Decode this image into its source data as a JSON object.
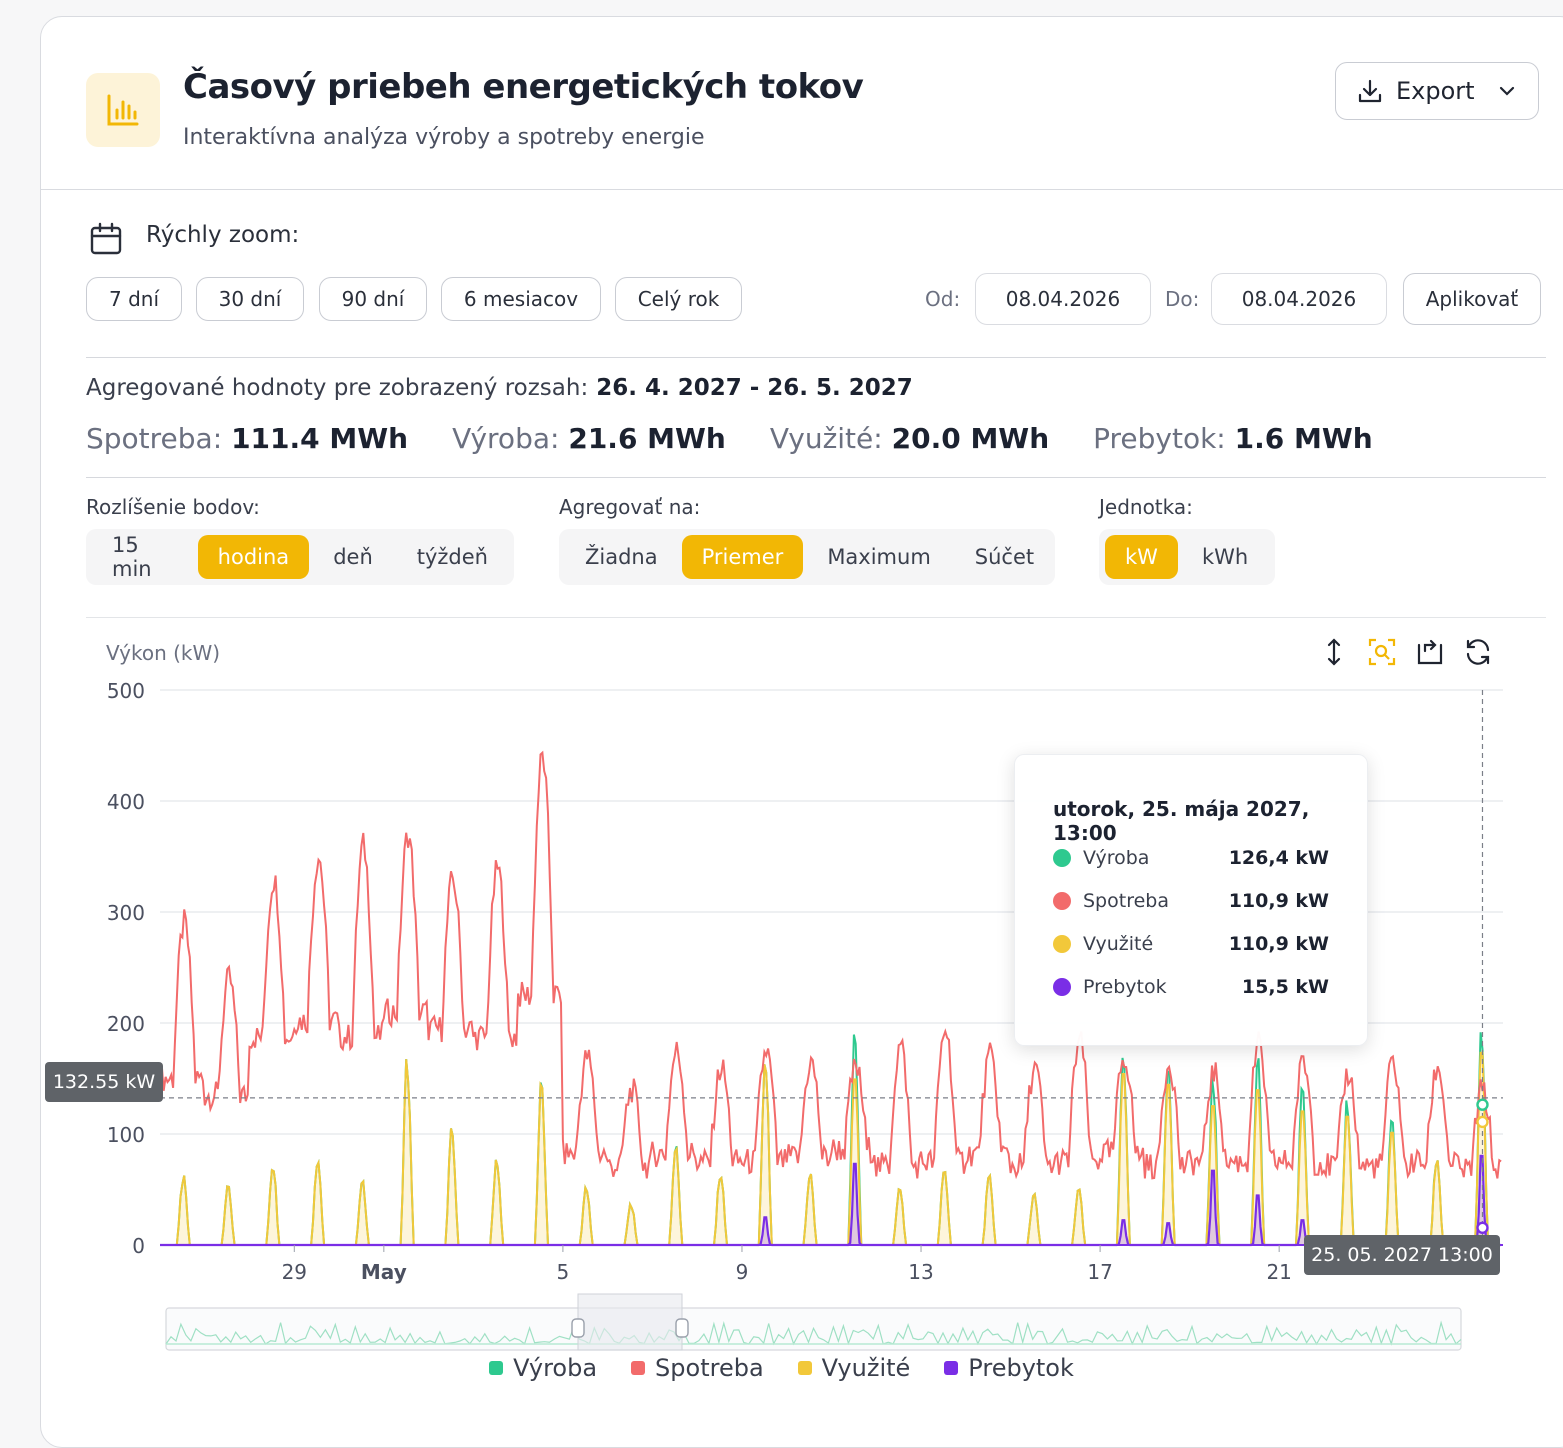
{
  "header": {
    "title": "Časový priebeh energetických tokov",
    "subtitle": "Interaktívna analýza výroby a spotreby energie",
    "export_label": "Export"
  },
  "zoom": {
    "label": "Rýchly zoom:",
    "buttons": [
      "7 dní",
      "30 dní",
      "90 dní",
      "6 mesiacov",
      "Celý rok"
    ],
    "from_label": "Od:",
    "from_value": "08.04.2026",
    "to_label": "Do:",
    "to_value": "08.04.2026",
    "apply_label": "Aplikovať"
  },
  "aggregate": {
    "label": "Agregované hodnoty pre zobrazený rozsah:",
    "range": "26. 4. 2027 - 26. 5. 2027",
    "stats": [
      {
        "label": "Spotreba:",
        "value": "111.4 MWh"
      },
      {
        "label": "Výroba:",
        "value": "21.6 MWh"
      },
      {
        "label": "Využité:",
        "value": "20.0 MWh"
      },
      {
        "label": "Prebytok:",
        "value": "1.6 MWh"
      }
    ]
  },
  "controls": {
    "resolution_label": "Rozlíšenie bodov:",
    "resolution_options": [
      "15 min",
      "hodina",
      "deň",
      "týždeň"
    ],
    "resolution_active": "hodina",
    "aggregate_label": "Agregovať na:",
    "aggregate_options": [
      "Žiadna",
      "Priemer",
      "Maximum",
      "Súčet"
    ],
    "aggregate_active": "Priemer",
    "unit_label": "Jednotka:",
    "unit_options": [
      "kW",
      "kWh"
    ],
    "unit_active": "kW"
  },
  "colors": {
    "accent": "#f2b705",
    "vyroba": "#2ec98f",
    "spotreba": "#f26b6b",
    "vyuzite": "#f2c83a",
    "prebytok": "#7a2ee6"
  },
  "tooltip": {
    "title": "utorok, 25. mája 2027, 13:00",
    "rows": [
      {
        "name": "Výroba",
        "value": "126,4 kW"
      },
      {
        "name": "Spotreba",
        "value": "110,9 kW"
      },
      {
        "name": "Využité",
        "value": "110,9 kW"
      },
      {
        "name": "Prebytok",
        "value": "15,5 kW"
      }
    ]
  },
  "crosshair": {
    "y_label": "132.55 kW",
    "x_label": "25. 05. 2027 13:00"
  },
  "chart_data": {
    "type": "line",
    "ylabel": "Výkon (kW)",
    "ylim": [
      0,
      500
    ],
    "yticks": [
      0,
      100,
      200,
      300,
      400,
      500
    ],
    "xlim": [
      "2027-04-26",
      "2027-05-26"
    ],
    "xticks": [
      {
        "label": "29",
        "date": "2027-04-29"
      },
      {
        "label": "May",
        "date": "2027-05-01"
      },
      {
        "label": "5",
        "date": "2027-05-05"
      },
      {
        "label": "9",
        "date": "2027-05-09"
      },
      {
        "label": "13",
        "date": "2027-05-13"
      },
      {
        "label": "17",
        "date": "2027-05-17"
      },
      {
        "label": "21",
        "date": "2027-05-21"
      }
    ],
    "grid": true,
    "legend": "bottom",
    "daily": {
      "dates": [
        "2027-04-26",
        "2027-04-27",
        "2027-04-28",
        "2027-04-29",
        "2027-04-30",
        "2027-05-01",
        "2027-05-02",
        "2027-05-03",
        "2027-05-04",
        "2027-05-05",
        "2027-05-06",
        "2027-05-07",
        "2027-05-08",
        "2027-05-09",
        "2027-05-10",
        "2027-05-11",
        "2027-05-12",
        "2027-05-13",
        "2027-05-14",
        "2027-05-15",
        "2027-05-16",
        "2027-05-17",
        "2027-05-18",
        "2027-05-19",
        "2027-05-20",
        "2027-05-21",
        "2027-05-22",
        "2027-05-23",
        "2027-05-24",
        "2027-05-25"
      ],
      "spotreba_base": [
        200,
        180,
        250,
        270,
        250,
        280,
        260,
        250,
        300,
        110,
        95,
        110,
        100,
        100,
        105,
        115,
        95,
        100,
        110,
        95,
        100,
        110,
        95,
        100,
        100,
        100,
        95,
        95,
        100,
        90
      ],
      "spotreba_peak": [
        290,
        240,
        330,
        350,
        360,
        370,
        330,
        340,
        440,
        170,
        140,
        175,
        160,
        175,
        165,
        160,
        180,
        195,
        170,
        160,
        185,
        170,
        165,
        155,
        180,
        165,
        155,
        165,
        160,
        140
      ],
      "vyroba_peak": [
        65,
        55,
        80,
        85,
        60,
        180,
        110,
        80,
        155,
        55,
        40,
        95,
        70,
        180,
        70,
        200,
        55,
        75,
        65,
        50,
        55,
        190,
        180,
        160,
        175,
        150,
        140,
        120,
        85,
        200
      ],
      "vyuzite_peak": [
        65,
        55,
        80,
        85,
        60,
        175,
        110,
        80,
        150,
        55,
        40,
        90,
        70,
        175,
        70,
        155,
        55,
        75,
        65,
        50,
        55,
        160,
        150,
        130,
        145,
        125,
        120,
        105,
        80,
        180
      ],
      "prebytok_peak": [
        0,
        0,
        0,
        0,
        0,
        0,
        0,
        0,
        0,
        0,
        0,
        0,
        0,
        28,
        0,
        82,
        0,
        0,
        0,
        0,
        0,
        25,
        22,
        75,
        50,
        25,
        0,
        0,
        0,
        90
      ]
    }
  },
  "series": [
    {
      "name": "Výroba",
      "color": "#2ec98f"
    },
    {
      "name": "Spotreba",
      "color": "#f26b6b"
    },
    {
      "name": "Využité",
      "color": "#f2c83a"
    },
    {
      "name": "Prebytok",
      "color": "#7a2ee6"
    }
  ]
}
